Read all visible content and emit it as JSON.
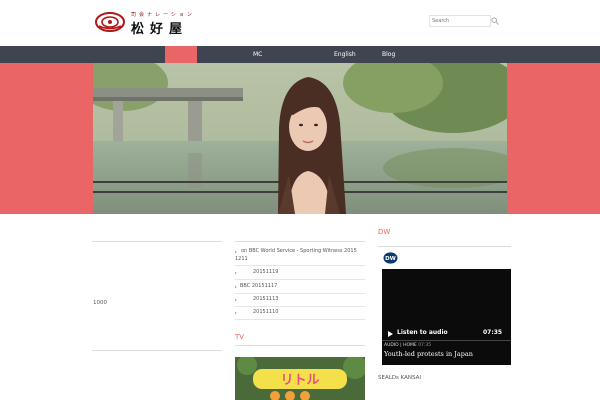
{
  "header": {
    "logo": {
      "subtitle": "司会ナレーション",
      "name": "松好屋"
    },
    "search": {
      "placeholder": "Search"
    }
  },
  "nav": {
    "items": [
      {
        "label": "MC"
      },
      {
        "label": "English"
      },
      {
        "label": "Blog"
      }
    ],
    "active_color": "#ea6565",
    "bar_color": "#3f4550"
  },
  "left_column": {
    "text": "1000"
  },
  "middle_column": {
    "posts": [
      {
        "lines": [
          "on BBC World Service - Sporting Witness   2015",
          "1211"
        ]
      },
      {
        "lines": [
          "20151119"
        ]
      },
      {
        "lines": [
          "BBC 20151117"
        ]
      },
      {
        "lines": [
          "20151113"
        ]
      },
      {
        "lines": [
          "20151110"
        ]
      }
    ],
    "tv_title": "TV"
  },
  "right_column": {
    "dw_title": "DW",
    "widget": {
      "logo": "DW",
      "listen_label": "Listen to audio",
      "duration": "07:35",
      "meta": "AUDIO | HOME",
      "meta_time": "07:35",
      "headline": "Youth-led protests in Japan"
    },
    "caption": "SEALDs KANSAI"
  },
  "colors": {
    "accent": "#ea6565",
    "dark": "#3f4550"
  }
}
